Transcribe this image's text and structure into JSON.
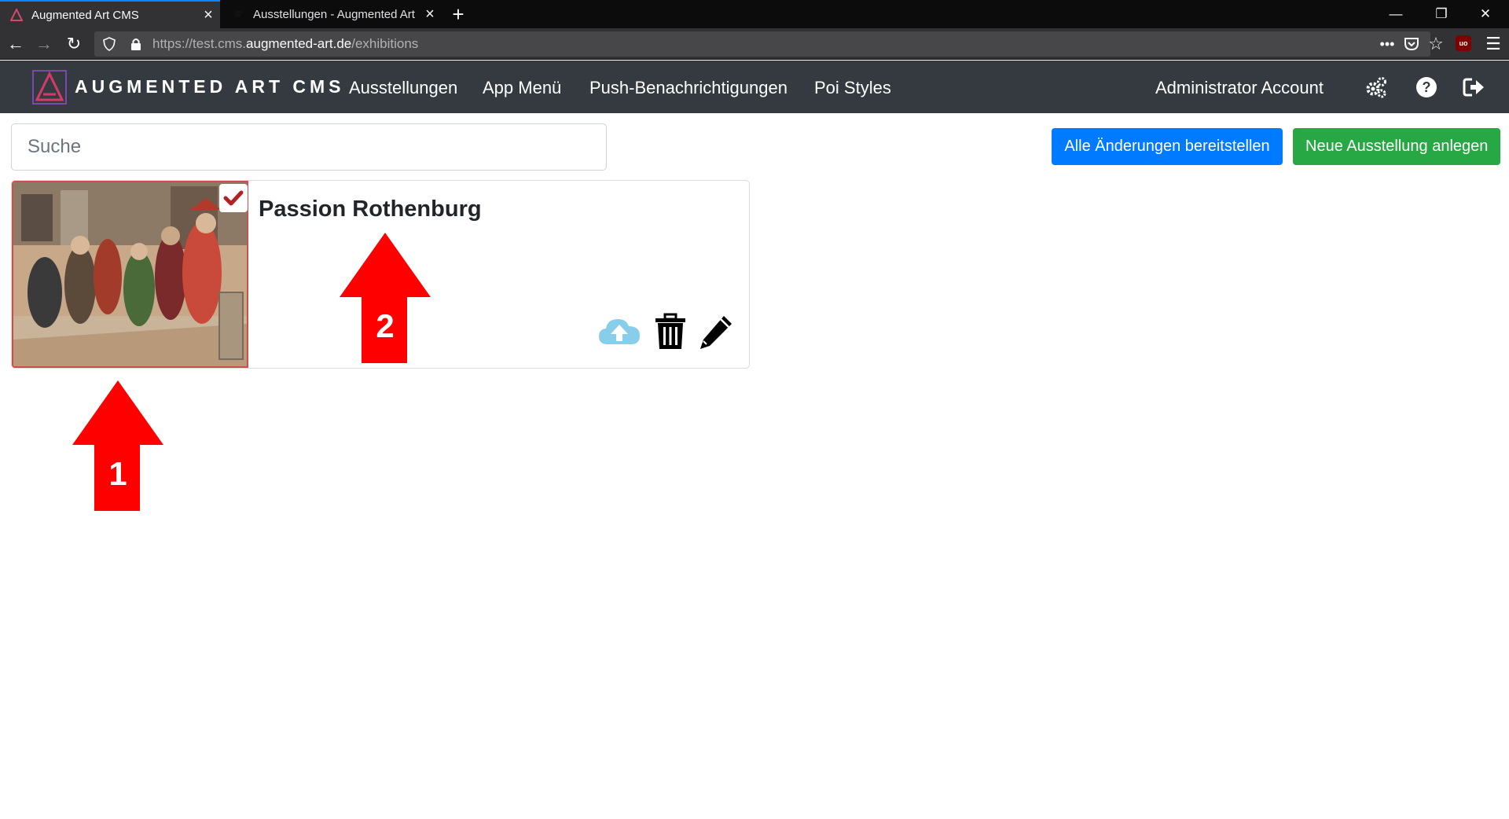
{
  "browser": {
    "tabs": [
      {
        "title": "Augmented Art CMS",
        "active": true
      },
      {
        "title": "Ausstellungen - Augmented Art",
        "active": false
      }
    ],
    "new_tab_icon": "plus-icon",
    "url": {
      "prefix": "https://test.cms.",
      "host": "augmented-art.de",
      "path": "/exhibitions"
    },
    "window_controls": [
      "minimize-icon",
      "restore-icon",
      "close-icon"
    ],
    "toolbar_icons": [
      "page-actions-icon",
      "pocket-icon",
      "bookmark-star-icon",
      "ublock-icon",
      "menu-icon"
    ],
    "ublock_label": "uo"
  },
  "app": {
    "brand": "AUGMENTED ART CMS",
    "nav": {
      "exhibitions": "Ausstellungen",
      "app_menu": "App Menü",
      "push": "Push-Benachrichtigungen",
      "poi_styles": "Poi Styles",
      "account": "Administrator Account"
    },
    "nav_icons": [
      "settings-gears-icon",
      "help-icon",
      "logout-icon"
    ],
    "colors": {
      "navbar": "#343a40",
      "primary": "#007bff",
      "success": "#28a745",
      "check": "#b22222",
      "cloud": "#87ceeb"
    }
  },
  "toolbar": {
    "search_placeholder": "Suche",
    "deploy_all": "Alle Änderungen bereitstellen",
    "new_exhibition": "Neue Ausstellung anlegen"
  },
  "exhibitions": [
    {
      "title": "Passion Rothenburg",
      "selected": true,
      "actions": [
        "upload-cloud-icon",
        "trash-icon",
        "edit-pencil-icon"
      ]
    }
  ],
  "annotations": {
    "arrow_1": "1",
    "arrow_2": "2"
  }
}
